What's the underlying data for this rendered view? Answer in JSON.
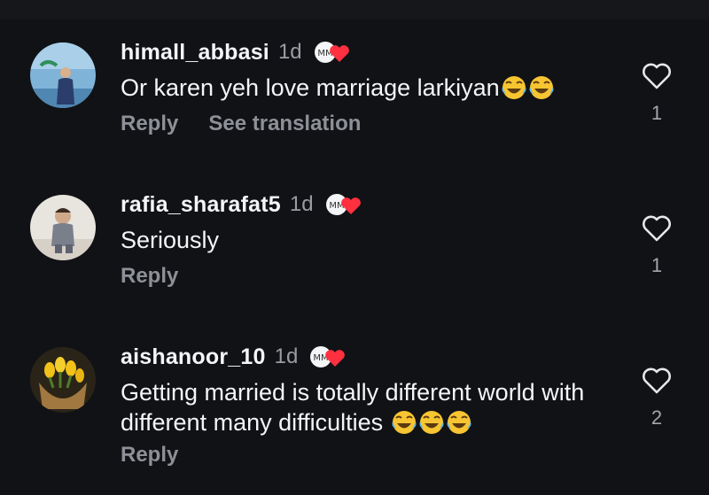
{
  "comments": [
    {
      "username": "himall_abbasi",
      "time": "1d",
      "text": "Or karen yeh love marriage larkiyan",
      "emoji_count": 2,
      "actions": [
        "Reply",
        "See translation"
      ],
      "likes": "1",
      "avatar_icon": "avatar-photo-person-blue-room"
    },
    {
      "username": "rafia_sharafat5",
      "time": "1d",
      "text": "Seriously",
      "emoji_count": 0,
      "actions": [
        "Reply"
      ],
      "likes": "1",
      "avatar_icon": "avatar-photo-child-sitting"
    },
    {
      "username": "aishanoor_10",
      "time": "1d",
      "text": "Getting married is totally different world with different many difficulties",
      "emoji_count": 3,
      "actions": [
        "Reply"
      ],
      "likes": "2",
      "avatar_icon": "avatar-photo-yellow-tulips"
    }
  ],
  "badge": {
    "icon": "creator-liked-heart-badge",
    "heart_color": "#ff3040"
  },
  "colors": {
    "background": "#111216",
    "muted": "#8e9097",
    "text": "#f4f5f7"
  },
  "emoji_name": "face-with-tears-of-joy"
}
